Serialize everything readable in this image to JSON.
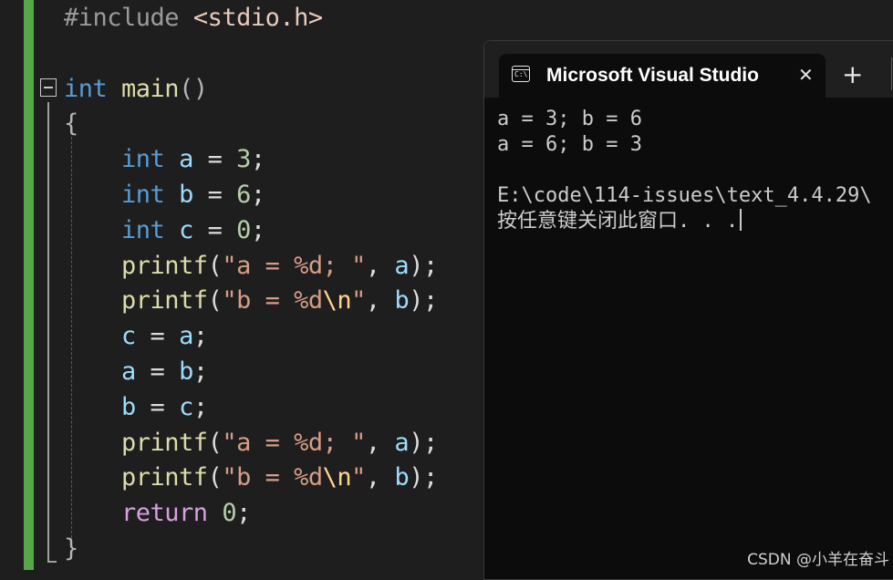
{
  "editor": {
    "lines": [
      [
        [
          "pp",
          "#include "
        ],
        [
          "inc",
          "<stdio.h>"
        ]
      ],
      [],
      [
        [
          "kw",
          "int "
        ],
        [
          "fn",
          "main"
        ],
        [
          "punc",
          "()"
        ]
      ],
      [
        [
          "punc",
          "{"
        ]
      ],
      [
        [
          "t",
          "    "
        ],
        [
          "kw",
          "int "
        ],
        [
          "var",
          "a"
        ],
        [
          "t",
          " = "
        ],
        [
          "num",
          "3"
        ],
        [
          "t",
          ";"
        ]
      ],
      [
        [
          "t",
          "    "
        ],
        [
          "kw",
          "int "
        ],
        [
          "var",
          "b"
        ],
        [
          "t",
          " = "
        ],
        [
          "num",
          "6"
        ],
        [
          "t",
          ";"
        ]
      ],
      [
        [
          "t",
          "    "
        ],
        [
          "kw",
          "int "
        ],
        [
          "var",
          "c"
        ],
        [
          "t",
          " = "
        ],
        [
          "num",
          "0"
        ],
        [
          "t",
          ";"
        ]
      ],
      [
        [
          "t",
          "    "
        ],
        [
          "fn",
          "printf"
        ],
        [
          "t",
          "("
        ],
        [
          "str",
          "\"a = %d; \""
        ],
        [
          "t",
          ", "
        ],
        [
          "var",
          "a"
        ],
        [
          "t",
          ");"
        ]
      ],
      [
        [
          "t",
          "    "
        ],
        [
          "fn",
          "printf"
        ],
        [
          "t",
          "("
        ],
        [
          "str",
          "\"b = %d"
        ],
        [
          "esc",
          "\\n"
        ],
        [
          "str",
          "\""
        ],
        [
          "t",
          ", "
        ],
        [
          "var",
          "b"
        ],
        [
          "t",
          ");"
        ]
      ],
      [
        [
          "t",
          "    "
        ],
        [
          "var",
          "c"
        ],
        [
          "t",
          " = "
        ],
        [
          "var",
          "a"
        ],
        [
          "t",
          ";"
        ]
      ],
      [
        [
          "t",
          "    "
        ],
        [
          "var",
          "a"
        ],
        [
          "t",
          " = "
        ],
        [
          "var",
          "b"
        ],
        [
          "t",
          ";"
        ]
      ],
      [
        [
          "t",
          "    "
        ],
        [
          "var",
          "b"
        ],
        [
          "t",
          " = "
        ],
        [
          "var",
          "c"
        ],
        [
          "t",
          ";"
        ]
      ],
      [
        [
          "t",
          "    "
        ],
        [
          "fn",
          "printf"
        ],
        [
          "t",
          "("
        ],
        [
          "str",
          "\"a = %d; \""
        ],
        [
          "t",
          ", "
        ],
        [
          "var",
          "a"
        ],
        [
          "t",
          ");"
        ]
      ],
      [
        [
          "t",
          "    "
        ],
        [
          "fn",
          "printf"
        ],
        [
          "t",
          "("
        ],
        [
          "str",
          "\"b = %d"
        ],
        [
          "esc",
          "\\n"
        ],
        [
          "str",
          "\""
        ],
        [
          "t",
          ", "
        ],
        [
          "var",
          "b"
        ],
        [
          "t",
          ");"
        ]
      ],
      [
        [
          "t",
          "    "
        ],
        [
          "ctl",
          "return "
        ],
        [
          "num",
          "0"
        ],
        [
          "t",
          ";"
        ]
      ],
      [
        [
          "punc",
          "}"
        ]
      ]
    ]
  },
  "terminal": {
    "tab_title": "Microsoft Visual Studio",
    "tab_icon": "console-icon",
    "tab_icon_text": "C:\\",
    "close_glyph": "✕",
    "new_tab_glyph": "+",
    "output": [
      "a = 3; b = 6",
      "a = 6; b = 3",
      "",
      "E:\\code\\114-issues\\text_4.4.29\\",
      "按任意键关闭此窗口. . ."
    ]
  },
  "watermark": "CSDN @小羊在奋斗",
  "colors": {
    "editor_bg": "#1e1e1e",
    "change_bar": "#57a64a",
    "keyword": "#569cd6",
    "function": "#dcdcaa",
    "variable": "#9cdcfe",
    "number": "#b5cea8",
    "string": "#d69d85",
    "terminal_bg": "#0c0c0c"
  }
}
